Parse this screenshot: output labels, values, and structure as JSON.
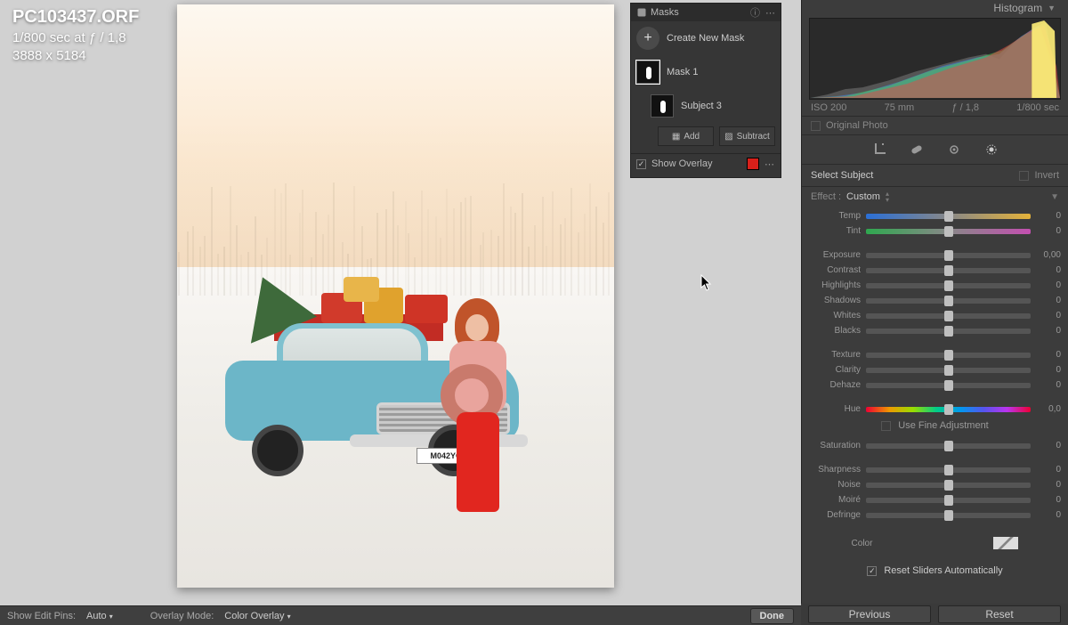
{
  "file": {
    "name": "PC103437.ORF",
    "exposure": "1/800 sec at ƒ / 1,8",
    "dimensions": "3888 x 5184",
    "plate": "M042YC"
  },
  "masks": {
    "title": "Masks",
    "create": "Create New Mask",
    "mask1": "Mask 1",
    "subject": "Subject 3",
    "add": "Add",
    "subtract": "Subtract",
    "show_overlay": "Show Overlay"
  },
  "hist": {
    "title": "Histogram",
    "iso": "ISO 200",
    "focal": "75 mm",
    "aperture": "ƒ / 1,8",
    "shutter": "1/800 sec",
    "original": "Original Photo"
  },
  "panel": {
    "select_subject": "Select Subject",
    "invert": "Invert",
    "effect_label": "Effect :",
    "effect_value": "Custom",
    "fine": "Use Fine Adjustment",
    "color_label": "Color",
    "reset_auto": "Reset Sliders Automatically"
  },
  "sliders": {
    "temp": {
      "label": "Temp",
      "value": "0",
      "pos": 50,
      "cls": "grad-temp"
    },
    "tint": {
      "label": "Tint",
      "value": "0",
      "pos": 50,
      "cls": "grad-tint"
    },
    "exposure": {
      "label": "Exposure",
      "value": "0,00",
      "pos": 50
    },
    "contrast": {
      "label": "Contrast",
      "value": "0",
      "pos": 50
    },
    "highlights": {
      "label": "Highlights",
      "value": "0",
      "pos": 50
    },
    "shadows": {
      "label": "Shadows",
      "value": "0",
      "pos": 50
    },
    "whites": {
      "label": "Whites",
      "value": "0",
      "pos": 50
    },
    "blacks": {
      "label": "Blacks",
      "value": "0",
      "pos": 50
    },
    "texture": {
      "label": "Texture",
      "value": "0",
      "pos": 50
    },
    "clarity": {
      "label": "Clarity",
      "value": "0",
      "pos": 50
    },
    "dehaze": {
      "label": "Dehaze",
      "value": "0",
      "pos": 50
    },
    "hue": {
      "label": "Hue",
      "value": "0,0",
      "pos": 50,
      "cls": "grad-hue"
    },
    "saturation": {
      "label": "Saturation",
      "value": "0",
      "pos": 50
    },
    "sharpness": {
      "label": "Sharpness",
      "value": "0",
      "pos": 50
    },
    "noise": {
      "label": "Noise",
      "value": "0",
      "pos": 50
    },
    "moire": {
      "label": "Moiré",
      "value": "0",
      "pos": 50
    },
    "defringe": {
      "label": "Defringe",
      "value": "0",
      "pos": 50
    }
  },
  "bottom": {
    "show_pins": "Show Edit Pins:",
    "pins_value": "Auto",
    "overlay_mode": "Overlay Mode:",
    "overlay_value": "Color Overlay",
    "done": "Done",
    "previous": "Previous",
    "reset": "Reset"
  }
}
